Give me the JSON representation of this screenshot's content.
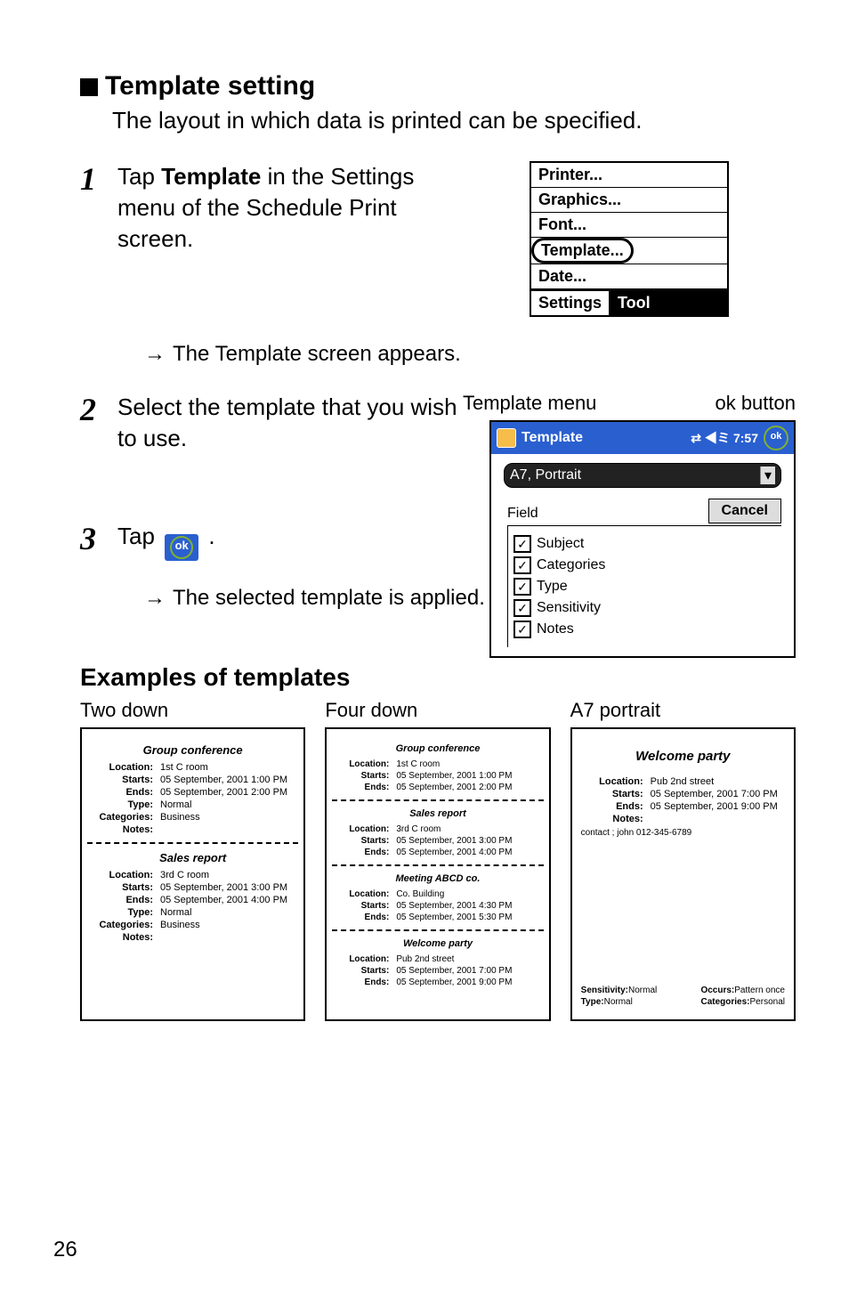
{
  "section": {
    "title": "Template setting",
    "intro": "The layout in which data is printed can be specified."
  },
  "steps": {
    "s1": {
      "num": "1",
      "text_prefix": "Tap ",
      "text_bold": "Template",
      "text_suffix": " in the Settings menu of the Schedule Print screen.",
      "result": "The Template screen appears."
    },
    "s2": {
      "num": "2",
      "text": "Select the template that you wish to use."
    },
    "s3": {
      "num": "3",
      "text_prefix": "Tap ",
      "text_suffix": " .",
      "result": "The selected template is applied."
    }
  },
  "settings_menu": {
    "items": [
      "Printer...",
      "Graphics...",
      "Font...",
      "Template...",
      "Date..."
    ],
    "tabs": {
      "active": "Settings",
      "inactive": "Tool"
    }
  },
  "template_screen": {
    "label_left": "Template menu",
    "label_right": "ok button",
    "title": "Template",
    "time": "7:57",
    "ok": "ok",
    "selected": "A7, Portrait",
    "cancel": "Cancel",
    "field_label": "Field",
    "fields": [
      "Subject",
      "Categories",
      "Type",
      "Sensitivity",
      "Notes"
    ]
  },
  "examples": {
    "title": "Examples of templates",
    "col1": {
      "label": "Two down",
      "ev1": {
        "title": "Group conference",
        "rows": [
          [
            "Location:",
            "1st C room"
          ],
          [
            "Starts:",
            "05 September, 2001 1:00 PM"
          ],
          [
            "Ends:",
            "05 September, 2001 2:00 PM"
          ],
          [
            "Type:",
            "Normal"
          ],
          [
            "Categories:",
            "Business"
          ],
          [
            "Notes:",
            ""
          ]
        ]
      },
      "ev2": {
        "title": "Sales report",
        "rows": [
          [
            "Location:",
            "3rd C room"
          ],
          [
            "Starts:",
            "05 September, 2001 3:00 PM"
          ],
          [
            "Ends:",
            "05 September, 2001 4:00 PM"
          ],
          [
            "Type:",
            "Normal"
          ],
          [
            "Categories:",
            "Business"
          ],
          [
            "Notes:",
            ""
          ]
        ]
      }
    },
    "col2": {
      "label": "Four down",
      "ev1": {
        "title": "Group conference",
        "rows": [
          [
            "Location:",
            "1st C room"
          ],
          [
            "Starts:",
            "05 September, 2001 1:00 PM"
          ],
          [
            "Ends:",
            "05 September, 2001 2:00 PM"
          ]
        ]
      },
      "ev2": {
        "title": "Sales report",
        "rows": [
          [
            "Location:",
            "3rd C room"
          ],
          [
            "Starts:",
            "05 September, 2001 3:00 PM"
          ],
          [
            "Ends:",
            "05 September, 2001 4:00 PM"
          ]
        ]
      },
      "ev3": {
        "title": "Meeting ABCD co.",
        "rows": [
          [
            "Location:",
            "Co. Building"
          ],
          [
            "Starts:",
            "05 September, 2001 4:30 PM"
          ],
          [
            "Ends:",
            "05 September, 2001 5:30 PM"
          ]
        ]
      },
      "ev4": {
        "title": "Welcome party",
        "rows": [
          [
            "Location:",
            "Pub 2nd street"
          ],
          [
            "Starts:",
            "05 September, 2001 7:00 PM"
          ],
          [
            "Ends:",
            "05 September, 2001 9:00 PM"
          ]
        ]
      }
    },
    "col3": {
      "label": "A7 portrait",
      "ev1": {
        "title": "Welcome party",
        "rows": [
          [
            "Location:",
            "Pub 2nd street"
          ],
          [
            "Starts:",
            "05 September, 2001 7:00 PM"
          ],
          [
            "Ends:",
            "05 September, 2001 9:00 PM"
          ],
          [
            "Notes:",
            ""
          ]
        ],
        "contact": "contact ; john  012-345-6789"
      },
      "bottom": [
        [
          "Sensitivity:",
          "Normal",
          "Occurs:",
          "Pattern once"
        ],
        [
          "Type:",
          "Normal",
          "Categories:",
          "Personal"
        ]
      ]
    }
  },
  "page_number": "26"
}
